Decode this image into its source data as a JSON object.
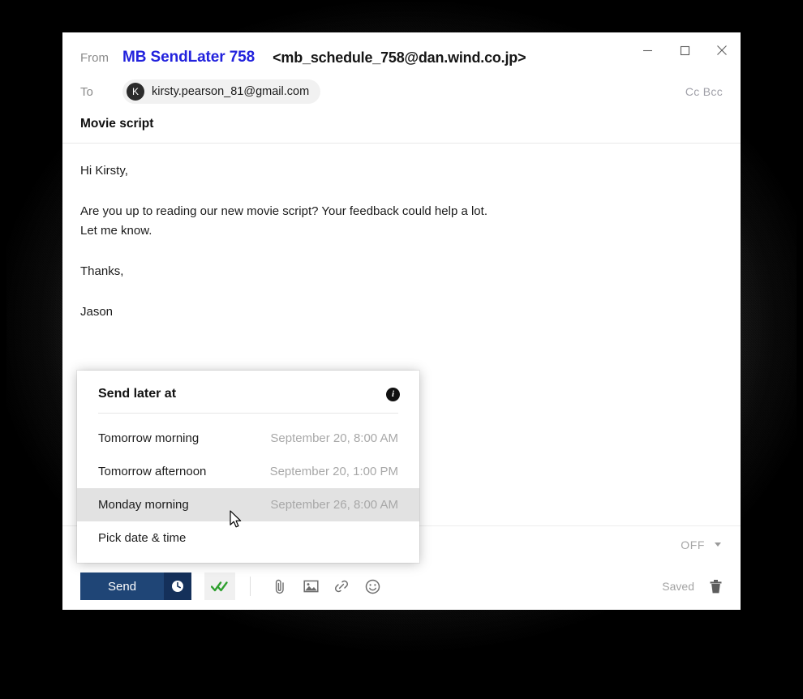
{
  "window": {
    "controls": {
      "minimize": "minimize",
      "maximize": "maximize",
      "close": "close"
    }
  },
  "header": {
    "from_label": "From",
    "from_name": "MB SendLater 758",
    "from_address": "<mb_schedule_758@dan.wind.co.jp>",
    "to_label": "To",
    "recipient_initial": "K",
    "recipient_email": "kirsty.pearson_81@gmail.com",
    "cc_bcc": "Cc Bcc"
  },
  "subject": {
    "text": "Movie script"
  },
  "body": {
    "lines": [
      "Hi Kirsty,",
      "Are you up to reading our new movie script? Your feedback could help a lot.",
      "Let me know.",
      "Thanks,",
      "Jason"
    ]
  },
  "format_toolbar": {
    "align_label": "align-left",
    "numbered_list_label": "numbered-list",
    "bulleted_list_label": "bulleted-list",
    "decrease_indent_label": "decrease-indent",
    "increase_indent_label": "increase-indent",
    "off_label": "OFF"
  },
  "action_bar": {
    "send_label": "Send",
    "send_later_label": "send-later",
    "tracking_label": "read-receipt",
    "attach_label": "attach-file",
    "image_label": "insert-image",
    "link_label": "insert-link",
    "emoji_label": "insert-emoji",
    "saved_label": "Saved",
    "discard_label": "discard"
  },
  "send_later_menu": {
    "title": "Send later at",
    "info_glyph": "i",
    "items": [
      {
        "label": "Tomorrow morning",
        "date": "September 20, 8:00 AM",
        "highlighted": false
      },
      {
        "label": "Tomorrow afternoon",
        "date": "September 20, 1:00 PM",
        "highlighted": false
      },
      {
        "label": "Monday morning",
        "date": "September 26, 8:00 AM",
        "highlighted": true
      },
      {
        "label": "Pick date & time",
        "date": "",
        "highlighted": false
      }
    ]
  },
  "colors": {
    "accent_blue": "#1f4576",
    "accent_blue_dark": "#14305a",
    "from_name_blue": "#2222dd",
    "check_green": "#2fa02f",
    "highlight_gray": "#e2e2e2"
  }
}
